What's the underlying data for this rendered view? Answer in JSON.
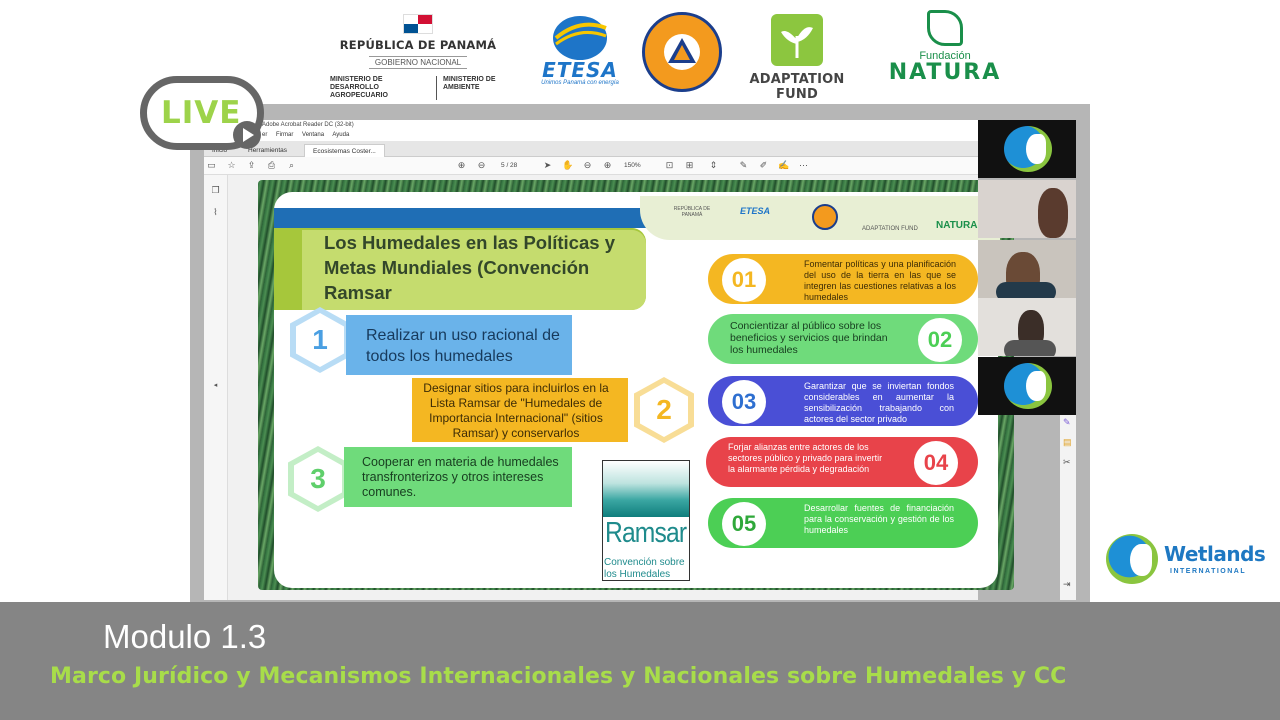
{
  "header_logos": {
    "panama": {
      "title": "REPÚBLICA DE PANAMÁ",
      "subtitle": "GOBIERNO NACIONAL",
      "ministry_1": "MINISTERIO DE DESARROLLO AGROPECUARIO",
      "ministry_2": "MINISTERIO DE AMBIENTE"
    },
    "etesa": {
      "name": "ETESA",
      "tagline": "Unimos Panamá con energía"
    },
    "sinaproc": {
      "name": "SISTEMA NACIONAL DE PROTECCIÓN CIVIL PANAMÁ"
    },
    "adaptation_fund": {
      "name": "ADAPTATION FUND"
    },
    "natura": {
      "prefix": "Fundación",
      "name": "NATURA"
    }
  },
  "live_badge": {
    "label": "LIVE"
  },
  "acrobat": {
    "window_title": "Adobe Acrobat Reader DC (32-bit)",
    "menu": [
      "er",
      "Firmar",
      "Ventana",
      "Ayuda"
    ],
    "tabs": [
      "Inicio",
      "Herramientas",
      "Ecosistemas Coster..."
    ],
    "page_current": "5",
    "page_total": "/ 28",
    "zoom": "150%"
  },
  "slide": {
    "title": "Los Humedales en las Políticas y Metas Mundiales (Convención Ramsar",
    "pillars": [
      {
        "number": "1",
        "text": "Realizar un uso racional de todos los humedales"
      },
      {
        "number": "2",
        "text": "Designar sitios para incluirlos en la Lista Ramsar de \"Humedales de Importancia Internacional\" (sitios Ramsar) y conservarlos"
      },
      {
        "number": "3",
        "text": "Cooperar en materia de humedales transfronterizos y otros intereses comunes."
      }
    ],
    "ramsar_logo": {
      "word": "Ramsar",
      "subtitle": "Convención sobre los Humedales"
    },
    "goals": [
      {
        "number": "01",
        "text": "Fomentar políticas y una planificación del uso de la tierra en las que se integren las cuestiones relativas a los humedales",
        "color": "#f4b722"
      },
      {
        "number": "02",
        "text": "Concientizar al público sobre los beneficios y servicios que brindan los humedales",
        "color": "#6fdb7b"
      },
      {
        "number": "03",
        "text": "Garantizar que se inviertan fondos considerables en aumentar la sensibilización trabajando con actores del sector privado",
        "color": "#4a4fd6"
      },
      {
        "number": "04",
        "text": "Forjar alianzas entre actores de los sectores público y privado para invertir la alarmante pérdida y degradación",
        "color": "#e8434a"
      },
      {
        "number": "05",
        "text": "Desarrollar fuentes de financiación para la conservación y gestión de los humedales",
        "color": "#4ccf55"
      }
    ]
  },
  "wetlands_logo": {
    "name": "Wetlands",
    "sub": "INTERNATIONAL"
  },
  "lower_third": {
    "module": "Modulo 1.3",
    "subtitle": "Marco Jurídico y Mecanismos Internacionales y Nacionales sobre Humedales y CC"
  }
}
